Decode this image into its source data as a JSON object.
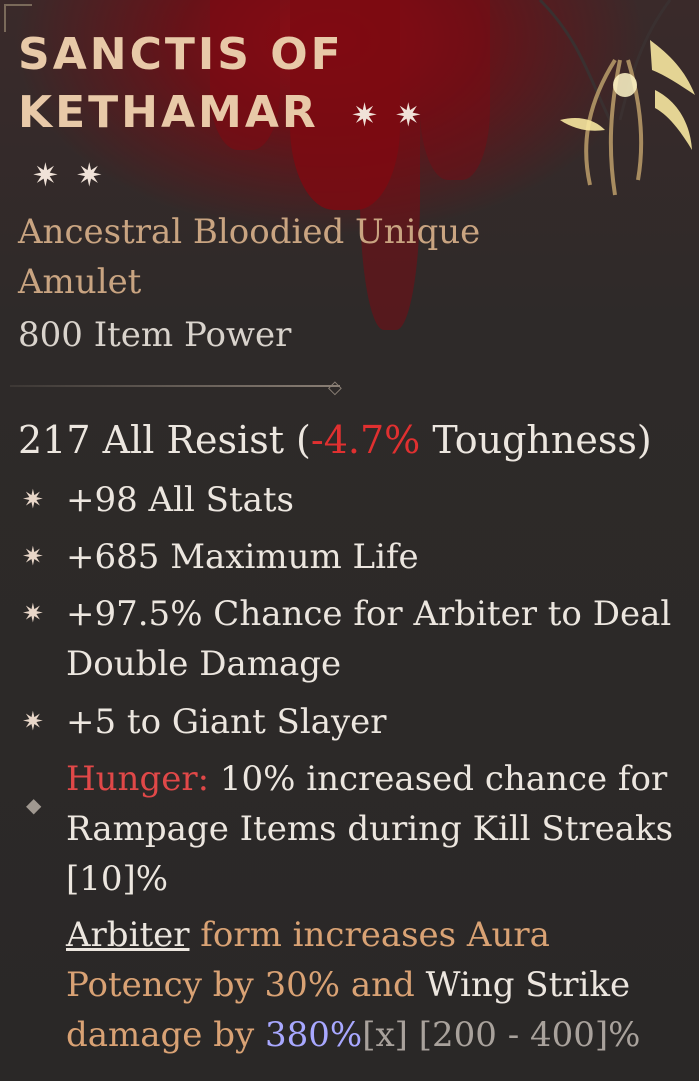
{
  "item": {
    "name_line1": "SANCTIS OF",
    "name_line2": "KETHAMAR",
    "type_line1": "Ancestral Bloodied Unique",
    "type_line2": "Amulet",
    "power": "800 Item Power",
    "resist_value": "217 All Resist (",
    "resist_neg": "-4.7%",
    "resist_suffix": " Toughness)",
    "affixes": [
      "+98 All Stats",
      "+685 Maximum Life",
      "+97.5% Chance for Arbiter to Deal Double Damage",
      "+5 to Giant Slayer"
    ],
    "hunger_label": "Hunger:",
    "hunger_text": " 10% increased chance for Rampage Items during Kill Streaks [10]%",
    "unique_power": {
      "p1": "Arbiter",
      "p2": " form increases Aura Potency by 30% and ",
      "p3": "Wing Strike",
      "p4": " damage by ",
      "p5": "380%",
      "p6": "[x] [200 - 400]%"
    }
  },
  "icons": {
    "greater_affix": "star-pip-icon",
    "hunger_bullet": "diamond-icon"
  },
  "colors": {
    "title": "#e8c9a8",
    "rarity": "#c9a481",
    "negative": "#e03030",
    "unique_gold": "#d9a274",
    "highlight": "#a8a8ff"
  }
}
